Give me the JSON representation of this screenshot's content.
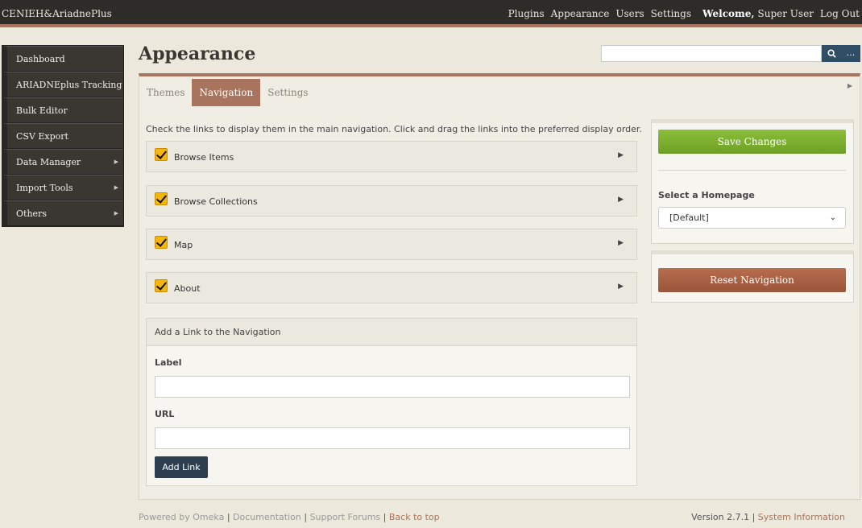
{
  "header": {
    "site_title": "CENIEH&AriadnePlus",
    "nav": [
      "Plugins",
      "Appearance",
      "Users",
      "Settings"
    ],
    "welcome": "Welcome,",
    "user": "Super User",
    "logout": "Log Out"
  },
  "sidebar": {
    "items": [
      {
        "label": "Dashboard",
        "submenu": false
      },
      {
        "label": "ARIADNEplus Tracking",
        "submenu": false
      },
      {
        "label": "Bulk Editor",
        "submenu": false
      },
      {
        "label": "CSV Export",
        "submenu": false
      },
      {
        "label": "Data Manager",
        "submenu": true
      },
      {
        "label": "Import Tools",
        "submenu": true
      },
      {
        "label": "Others",
        "submenu": true
      }
    ]
  },
  "page": {
    "title": "Appearance",
    "search_adv": "..."
  },
  "tabs": [
    "Themes",
    "Navigation",
    "Settings"
  ],
  "active_tab": "Navigation",
  "instructions": "Check the links to display them in the main navigation. Click and drag the links into the preferred display order.",
  "nav_links": [
    {
      "label": "Browse Items",
      "checked": true
    },
    {
      "label": "Browse Collections",
      "checked": true
    },
    {
      "label": "Map",
      "checked": true
    },
    {
      "label": "About",
      "checked": true
    }
  ],
  "add_link": {
    "heading": "Add a Link to the Navigation",
    "label_field": "Label",
    "url_field": "URL",
    "button": "Add Link"
  },
  "side": {
    "save": "Save Changes",
    "homepage_label": "Select a Homepage",
    "homepage_value": "[Default]",
    "reset": "Reset Navigation"
  },
  "footer": {
    "powered": "Powered by Omeka",
    "sep": "|",
    "documentation": "Documentation",
    "forums": "Support Forums",
    "back": "Back to top",
    "version": "Version 2.7.1",
    "system_info": "System Information"
  }
}
